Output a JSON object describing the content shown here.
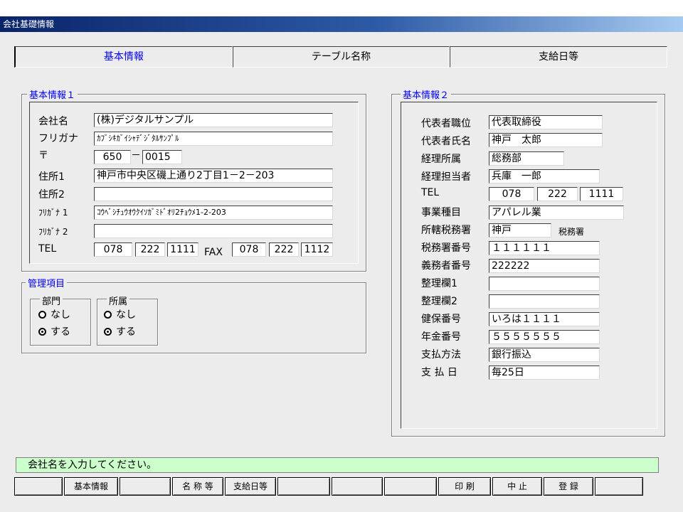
{
  "window": {
    "title": "会社基礎情報"
  },
  "tabs": [
    {
      "label": "基本情報"
    },
    {
      "label": "テーブル名称"
    },
    {
      "label": "支給日等"
    }
  ],
  "basic1": {
    "legend": "基本情報１",
    "company_name_label": "会社名",
    "company_name": "(株)デジタルサンプル",
    "furigana_label": "フリガナ",
    "furigana": "ｶﾌﾞｼｷｶﾞｲｼｬﾃﾞｼﾞﾀﾙｻﾝﾌﾟﾙ",
    "zip_label": "〒",
    "zip1": "650",
    "zip_sep": "－",
    "zip2": "0015",
    "addr1_label": "住所1",
    "addr1": "神戸市中央区磯上通り2丁目1－2－203",
    "addr2_label": "住所2",
    "addr2": "",
    "kana1_label": "ﾌﾘｶﾞﾅ 1",
    "kana1": "ｺｳﾍﾞｼﾁｭｳｵｳｸｲｿｶﾞﾐﾄﾞｵﾘ2ﾁｮｳﾒ1-2-203",
    "kana2_label": "ﾌﾘｶﾞﾅ 2",
    "kana2": "",
    "tel_label": "TEL",
    "tel": [
      "078",
      "222",
      "1111"
    ],
    "fax_label": "FAX",
    "fax": [
      "078",
      "222",
      "1112"
    ]
  },
  "mgmt": {
    "legend": "管理項目",
    "dept": {
      "legend": "部門",
      "options": [
        "なし",
        "する"
      ],
      "selected": 1
    },
    "affil": {
      "legend": "所属",
      "options": [
        "なし",
        "する"
      ],
      "selected": 1
    }
  },
  "basic2": {
    "legend": "基本情報２",
    "rep_title_label": "代表者職位",
    "rep_title": "代表取締役",
    "rep_name_label": "代表者氏名",
    "rep_name": "神戸　太郎",
    "acct_dept_label": "経理所属",
    "acct_dept": "総務部",
    "acct_person_label": "経理担当者",
    "acct_person": "兵庫　一郎",
    "tel_label": "TEL",
    "tel": [
      "078",
      "222",
      "1111"
    ],
    "business_label": "事業種目",
    "business": "アパレル業",
    "tax_office_label": "所轄税務署",
    "tax_office": "神戸",
    "tax_office_suffix": "税務署",
    "tax_office_no_label": "税務署番号",
    "tax_office_no": "１１１１１１",
    "obligor_no_label": "義務者番号",
    "obligor_no": "222222",
    "memo1_label": "整理欄1",
    "memo1": "",
    "memo2_label": "整理欄2",
    "memo2": "",
    "health_no_label": "健保番号",
    "health_no": "いろは１１１１",
    "pension_no_label": "年金番号",
    "pension_no": "５５５５５５５",
    "pay_method_label": "支払方法",
    "pay_method": "銀行振込",
    "pay_day_label": "支 払 日",
    "pay_day": "毎25日"
  },
  "status": {
    "message": "会社名を入力してください。"
  },
  "function_keys": [
    "",
    "基本情報",
    "",
    "名 称 等",
    "支給日等",
    "",
    "",
    "",
    "印 刷",
    "中 止",
    "登 録",
    ""
  ]
}
